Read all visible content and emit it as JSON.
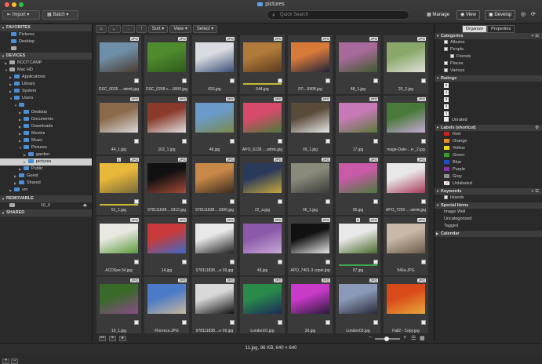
{
  "window": {
    "title": "pictures"
  },
  "toolbar": {
    "import_label": "Import",
    "batch_label": "Batch",
    "search_placeholder": "Quick Search",
    "manage_label": "Manage",
    "view_label": "View",
    "develop_label": "Develop"
  },
  "sidebar": {
    "favorites_title": "FAVORITES",
    "favorites": [
      "Pictures",
      "Desktop",
      ""
    ],
    "devices_title": "DEVICES",
    "devices": [
      {
        "label": "BOOTCAMP",
        "indent": 1,
        "type": "hd"
      },
      {
        "label": "Mac HD",
        "indent": 1,
        "type": "hd"
      },
      {
        "label": "Applications",
        "indent": 2,
        "type": "folder"
      },
      {
        "label": "Library",
        "indent": 2,
        "type": "folder"
      },
      {
        "label": "System",
        "indent": 2,
        "type": "folder"
      },
      {
        "label": "Users",
        "indent": 2,
        "type": "folder"
      },
      {
        "label": "",
        "indent": 3,
        "type": "folder"
      },
      {
        "label": "Desktop",
        "indent": 4,
        "type": "folder"
      },
      {
        "label": "Documents",
        "indent": 4,
        "type": "folder"
      },
      {
        "label": "Downloads",
        "indent": 4,
        "type": "folder"
      },
      {
        "label": "Movies",
        "indent": 4,
        "type": "folder"
      },
      {
        "label": "Music",
        "indent": 4,
        "type": "folder"
      },
      {
        "label": "Pictures",
        "indent": 4,
        "type": "folder"
      },
      {
        "label": "garden",
        "indent": 5,
        "type": "folder"
      },
      {
        "label": "pictures",
        "indent": 5,
        "type": "folder",
        "selected": true
      },
      {
        "label": "Public",
        "indent": 4,
        "type": "folder"
      },
      {
        "label": "Guest",
        "indent": 3,
        "type": "folder"
      },
      {
        "label": "Shared",
        "indent": 3,
        "type": "folder"
      },
      {
        "label": "vm",
        "indent": 2,
        "type": "folder"
      }
    ],
    "removable_title": "REMOVABLE",
    "removable": [
      {
        "label": "16_0"
      }
    ],
    "shared_title": "SHARED"
  },
  "grid_toolbar": {
    "sort_label": "Sort",
    "view_label": "View",
    "select_label": "Select"
  },
  "thumbnails": [
    {
      "name": "DSC_0025 ....wtmk.jpg",
      "badge": "JPG",
      "c1": "#6f8fa8",
      "c2": "#4a3a2e"
    },
    {
      "name": "DSC_0258 c....0000.jpg",
      "badge": "JPG",
      "c1": "#4e8a2e",
      "c2": "#2f5a1a"
    },
    {
      "name": "653.jpg",
      "badge": "JPG",
      "c1": "#d8dce0",
      "c2": "#3b4f7a"
    },
    {
      "name": "544.jpg",
      "badge": "JPG",
      "c1": "#b07a3a",
      "c2": "#5a3a1e",
      "bar": "#c8b830"
    },
    {
      "name": "FP....9908.jpg",
      "badge": "JPG",
      "c1": "#d87a3a",
      "c2": "#1e2438"
    },
    {
      "name": "48_1.jpg",
      "badge": "JPG",
      "c1": "#a86a9a",
      "c2": "#3e5a2e"
    },
    {
      "name": "20_2.jpg",
      "badge": "JPG",
      "c1": "#8aa86a",
      "c2": "#e0e0d8"
    },
    {
      "name": "44_1.jpg",
      "badge": "JPG",
      "c1": "#8a6a4a",
      "c2": "#d8d8d8"
    },
    {
      "name": "102_1.jpg",
      "badge": "JPG",
      "c1": "#8a3a2a",
      "c2": "#e0e0e0"
    },
    {
      "name": "48.jpg",
      "badge": "JPG",
      "c1": "#6a9ac8",
      "c2": "#7a8a4a"
    },
    {
      "name": "APO_6139 ....wtmk.jpg",
      "badge": "JPG",
      "c1": "#d84a6a",
      "c2": "#4a7a3a"
    },
    {
      "name": "09_1.jpg",
      "badge": "JPG",
      "c1": "#5a4a3a",
      "c2": "#e8e8e8"
    },
    {
      "name": "17.jpg",
      "badge": "JPG",
      "c1": "#c87ab8",
      "c2": "#5a7a3a"
    },
    {
      "name": "mage-Date-...e-_2.jpg",
      "badge": "JPG",
      "c1": "#4a7a3a",
      "c2": "#c8a8d8"
    },
    {
      "name": "51_1.jpg",
      "badge": "JPG",
      "c1": "#e8b83a",
      "c2": "#7a6a3a",
      "num": "1",
      "bar": "#c8b830"
    },
    {
      "name": "978111838....0312.jpg",
      "badge": "JPG",
      "c1": "#111111",
      "c2": "#a84a3a"
    },
    {
      "name": "978111838....0306.jpg",
      "badge": "JPG",
      "c1": "#c8884a",
      "c2": "#3a2a1e"
    },
    {
      "name": "22_a.jpg",
      "badge": "JPG",
      "c1": "#2a3a5a",
      "c2": "#c8a83a"
    },
    {
      "name": "06_1.jpg",
      "badge": "JPG",
      "c1": "#8a8a7a",
      "c2": "#3a3a3a"
    },
    {
      "name": "05.jpg",
      "badge": "JPG",
      "c1": "#c85aa8",
      "c2": "#4a7a3a"
    },
    {
      "name": "APO_7250 ....wtmk.jpg",
      "badge": "JPG",
      "c1": "#e8e8e8",
      "c2": "#a83a5a"
    },
    {
      "name": "ACDSee 54.jpg",
      "badge": "JPG",
      "c1": "#e8e8e0",
      "c2": "#5a9a3a"
    },
    {
      "name": "14.jpg",
      "badge": "JPG",
      "c1": "#c83a3a",
      "c2": "#3a6ac8"
    },
    {
      "name": "978111838....e 09.jpg",
      "badge": "JPG",
      "c1": "#e8e8e8",
      "c2": "#222222"
    },
    {
      "name": "49.jpg",
      "badge": "JPG",
      "c1": "#8a5aa8",
      "c2": "#c8a8d8"
    },
    {
      "name": "APO_7401-3 copie.jpg",
      "badge": "JPG",
      "c1": "#111111",
      "c2": "#e8e8e8"
    },
    {
      "name": "07.jpg",
      "badge": "JPG",
      "c1": "#e8e8e8",
      "c2": "#4a6a2a",
      "num": "5",
      "bar": "#3aa84a"
    },
    {
      "name": "546a.JPG",
      "badge": "JPG",
      "c1": "#c8b8a8",
      "c2": "#6a5a4a"
    },
    {
      "name": "13_1.jpg",
      "badge": "JPG",
      "c1": "#3a6a2a",
      "c2": "#8a4a8a"
    },
    {
      "name": "Florence.JPG",
      "badge": "JPG",
      "c1": "#4a7ac8",
      "c2": "#c8b89a"
    },
    {
      "name": "978111838....e 09.jpg",
      "badge": "JPG",
      "c1": "#d8d8d8",
      "c2": "#111111"
    },
    {
      "name": "London01.jpg",
      "badge": "JPG",
      "c1": "#2a8a4a",
      "c2": "#1a2a5a"
    },
    {
      "name": "30.jpg",
      "badge": "JPG",
      "c1": "#c83ac8",
      "c2": "#2a1a3a"
    },
    {
      "name": "London03.jpg",
      "badge": "JPG",
      "c1": "#8a9ab8",
      "c2": "#2a2a3a"
    },
    {
      "name": "Fall2 - Copy.jpg",
      "badge": "JPG",
      "c1": "#d84a1a",
      "c2": "#e8a83a"
    }
  ],
  "status": {
    "text": "11.jpg, 96 KB, 640 × 640"
  },
  "rpanel": {
    "tabs": [
      "Organize",
      "Properties"
    ],
    "categories_title": "Categories",
    "categories": [
      {
        "label": "Albums",
        "indent": 0
      },
      {
        "label": "People",
        "indent": 0
      },
      {
        "label": "Friends",
        "indent": 1
      },
      {
        "label": "Places",
        "indent": 0
      },
      {
        "label": "Various",
        "indent": 0
      }
    ],
    "ratings_title": "Ratings",
    "ratings": [
      {
        "n": "5"
      },
      {
        "n": "4"
      },
      {
        "n": "3"
      },
      {
        "n": "2"
      },
      {
        "n": "1"
      },
      {
        "n": "",
        "label": "Unrated"
      }
    ],
    "labels_title": "Labels (shortcut)",
    "labels": [
      {
        "label": "Red",
        "color": "#d02020"
      },
      {
        "label": "Orange",
        "color": "#e88a20"
      },
      {
        "label": "Yellow",
        "color": "#e8d820"
      },
      {
        "label": "Green",
        "color": "#30a030"
      },
      {
        "label": "Blue",
        "color": "#2050c8"
      },
      {
        "label": "Purple",
        "color": "#8a30b0"
      },
      {
        "label": "Gray",
        "color": "#909090"
      },
      {
        "label": "Unlabeled",
        "color": "#eeeeee"
      }
    ],
    "keywords_title": "Keywords",
    "keywords": [
      "Islands"
    ],
    "special_title": "Special Items",
    "special": [
      "Image Well",
      "Uncategorized",
      "Tagged"
    ],
    "calendar_title": "Calendar"
  }
}
